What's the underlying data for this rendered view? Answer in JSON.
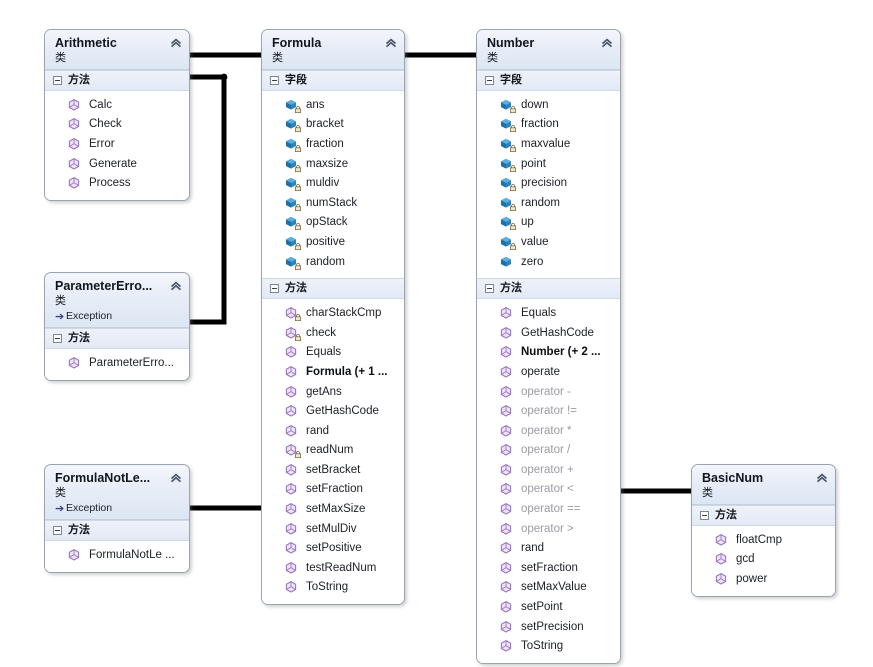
{
  "diagram": {
    "kind_label": "类",
    "section_fields_label": "字段",
    "section_methods_label": "方法",
    "collapse_icon": "chevron-double-up",
    "colors": {
      "field_icon": "#2b7bb9",
      "method_icon": "#a07cc5",
      "header_gradient_top": "#f3f6fb",
      "header_gradient_bottom": "#dde6f3",
      "connector": "#000000",
      "dimmed_text": "#9b9ba4",
      "text": "#1b1f26"
    }
  },
  "classes": [
    {
      "id": "arithmetic",
      "name": "Arithmetic",
      "kind": "类",
      "base": null,
      "sections": [
        {
          "label": "方法",
          "type": "methods",
          "members": [
            {
              "name": "Calc",
              "icon": "method-icon",
              "private": false,
              "dim": false,
              "bold": false
            },
            {
              "name": "Check",
              "icon": "method-icon",
              "private": false,
              "dim": false,
              "bold": false
            },
            {
              "name": "Error",
              "icon": "method-icon",
              "private": false,
              "dim": false,
              "bold": false
            },
            {
              "name": "Generate",
              "icon": "method-icon",
              "private": false,
              "dim": false,
              "bold": false
            },
            {
              "name": "Process",
              "icon": "method-icon",
              "private": false,
              "dim": false,
              "bold": false
            }
          ]
        }
      ]
    },
    {
      "id": "parameter-error",
      "name": "ParameterErro...",
      "kind": "类",
      "base": "Exception",
      "sections": [
        {
          "label": "方法",
          "type": "methods",
          "members": [
            {
              "name": "ParameterErro...",
              "icon": "method-icon",
              "private": false,
              "dim": false,
              "bold": false
            }
          ]
        }
      ]
    },
    {
      "id": "formula-not-legal",
      "name": "FormulaNotLe...",
      "kind": "类",
      "base": "Exception",
      "sections": [
        {
          "label": "方法",
          "type": "methods",
          "members": [
            {
              "name": "FormulaNotLe ...",
              "icon": "method-icon",
              "private": false,
              "dim": false,
              "bold": false
            }
          ]
        }
      ]
    },
    {
      "id": "formula",
      "name": "Formula",
      "kind": "类",
      "base": null,
      "sections": [
        {
          "label": "字段",
          "type": "fields",
          "members": [
            {
              "name": "ans",
              "icon": "field-icon",
              "private": true,
              "dim": false,
              "bold": false
            },
            {
              "name": "bracket",
              "icon": "field-icon",
              "private": true,
              "dim": false,
              "bold": false
            },
            {
              "name": "fraction",
              "icon": "field-icon",
              "private": true,
              "dim": false,
              "bold": false
            },
            {
              "name": "maxsize",
              "icon": "field-icon",
              "private": true,
              "dim": false,
              "bold": false
            },
            {
              "name": "muldiv",
              "icon": "field-icon",
              "private": true,
              "dim": false,
              "bold": false
            },
            {
              "name": "numStack",
              "icon": "field-icon",
              "private": true,
              "dim": false,
              "bold": false
            },
            {
              "name": "opStack",
              "icon": "field-icon",
              "private": true,
              "dim": false,
              "bold": false
            },
            {
              "name": "positive",
              "icon": "field-icon",
              "private": true,
              "dim": false,
              "bold": false
            },
            {
              "name": "random",
              "icon": "field-icon",
              "private": true,
              "dim": false,
              "bold": false
            }
          ]
        },
        {
          "label": "方法",
          "type": "methods",
          "members": [
            {
              "name": "charStackCmp",
              "icon": "method-icon",
              "private": true,
              "dim": false,
              "bold": false
            },
            {
              "name": "check",
              "icon": "method-icon",
              "private": true,
              "dim": false,
              "bold": false
            },
            {
              "name": "Equals",
              "icon": "method-icon",
              "private": false,
              "dim": false,
              "bold": false
            },
            {
              "name": "Formula (+ 1 ...",
              "icon": "method-icon",
              "private": false,
              "dim": false,
              "bold": true
            },
            {
              "name": "getAns",
              "icon": "method-icon",
              "private": false,
              "dim": false,
              "bold": false
            },
            {
              "name": "GetHashCode",
              "icon": "method-icon",
              "private": false,
              "dim": false,
              "bold": false
            },
            {
              "name": "rand",
              "icon": "method-icon",
              "private": false,
              "dim": false,
              "bold": false
            },
            {
              "name": "readNum",
              "icon": "method-icon",
              "private": true,
              "dim": false,
              "bold": false
            },
            {
              "name": "setBracket",
              "icon": "method-icon",
              "private": false,
              "dim": false,
              "bold": false
            },
            {
              "name": "setFraction",
              "icon": "method-icon",
              "private": false,
              "dim": false,
              "bold": false
            },
            {
              "name": "setMaxSize",
              "icon": "method-icon",
              "private": false,
              "dim": false,
              "bold": false
            },
            {
              "name": "setMulDiv",
              "icon": "method-icon",
              "private": false,
              "dim": false,
              "bold": false
            },
            {
              "name": "setPositive",
              "icon": "method-icon",
              "private": false,
              "dim": false,
              "bold": false
            },
            {
              "name": "testReadNum",
              "icon": "method-icon",
              "private": false,
              "dim": false,
              "bold": false
            },
            {
              "name": "ToString",
              "icon": "method-icon",
              "private": false,
              "dim": false,
              "bold": false
            }
          ]
        }
      ]
    },
    {
      "id": "number",
      "name": "Number",
      "kind": "类",
      "base": null,
      "sections": [
        {
          "label": "字段",
          "type": "fields",
          "members": [
            {
              "name": "down",
              "icon": "field-icon",
              "private": true,
              "dim": false,
              "bold": false
            },
            {
              "name": "fraction",
              "icon": "field-icon",
              "private": true,
              "dim": false,
              "bold": false
            },
            {
              "name": "maxvalue",
              "icon": "field-icon",
              "private": true,
              "dim": false,
              "bold": false
            },
            {
              "name": "point",
              "icon": "field-icon",
              "private": true,
              "dim": false,
              "bold": false
            },
            {
              "name": "precision",
              "icon": "field-icon",
              "private": true,
              "dim": false,
              "bold": false
            },
            {
              "name": "random",
              "icon": "field-icon",
              "private": true,
              "dim": false,
              "bold": false
            },
            {
              "name": "up",
              "icon": "field-icon",
              "private": true,
              "dim": false,
              "bold": false
            },
            {
              "name": "value",
              "icon": "field-icon",
              "private": true,
              "dim": false,
              "bold": false
            },
            {
              "name": "zero",
              "icon": "field-icon",
              "private": false,
              "dim": false,
              "bold": false
            }
          ]
        },
        {
          "label": "方法",
          "type": "methods",
          "members": [
            {
              "name": "Equals",
              "icon": "method-icon",
              "private": false,
              "dim": false,
              "bold": false
            },
            {
              "name": "GetHashCode",
              "icon": "method-icon",
              "private": false,
              "dim": false,
              "bold": false
            },
            {
              "name": "Number (+ 2 ...",
              "icon": "method-icon",
              "private": false,
              "dim": false,
              "bold": true
            },
            {
              "name": "operate",
              "icon": "method-icon",
              "private": false,
              "dim": false,
              "bold": false
            },
            {
              "name": "operator -",
              "icon": "method-icon",
              "private": false,
              "dim": true,
              "bold": false
            },
            {
              "name": "operator !=",
              "icon": "method-icon",
              "private": false,
              "dim": true,
              "bold": false
            },
            {
              "name": "operator *",
              "icon": "method-icon",
              "private": false,
              "dim": true,
              "bold": false
            },
            {
              "name": "operator /",
              "icon": "method-icon",
              "private": false,
              "dim": true,
              "bold": false
            },
            {
              "name": "operator +",
              "icon": "method-icon",
              "private": false,
              "dim": true,
              "bold": false
            },
            {
              "name": "operator <",
              "icon": "method-icon",
              "private": false,
              "dim": true,
              "bold": false
            },
            {
              "name": "operator ==",
              "icon": "method-icon",
              "private": false,
              "dim": true,
              "bold": false
            },
            {
              "name": "operator >",
              "icon": "method-icon",
              "private": false,
              "dim": true,
              "bold": false
            },
            {
              "name": "rand",
              "icon": "method-icon",
              "private": false,
              "dim": false,
              "bold": false
            },
            {
              "name": "setFraction",
              "icon": "method-icon",
              "private": false,
              "dim": false,
              "bold": false
            },
            {
              "name": "setMaxValue",
              "icon": "method-icon",
              "private": false,
              "dim": false,
              "bold": false
            },
            {
              "name": "setPoint",
              "icon": "method-icon",
              "private": false,
              "dim": false,
              "bold": false
            },
            {
              "name": "setPrecision",
              "icon": "method-icon",
              "private": false,
              "dim": false,
              "bold": false
            },
            {
              "name": "ToString",
              "icon": "method-icon",
              "private": false,
              "dim": false,
              "bold": false
            }
          ]
        }
      ]
    },
    {
      "id": "basic-num",
      "name": "BasicNum",
      "kind": "类",
      "base": null,
      "sections": [
        {
          "label": "方法",
          "type": "methods",
          "members": [
            {
              "name": "floatCmp",
              "icon": "method-icon",
              "private": false,
              "dim": false,
              "bold": false
            },
            {
              "name": "gcd",
              "icon": "method-icon",
              "private": false,
              "dim": false,
              "bold": false
            },
            {
              "name": "power",
              "icon": "method-icon",
              "private": false,
              "dim": false,
              "bold": false
            }
          ]
        }
      ]
    }
  ],
  "associations": [
    {
      "from": "arithmetic",
      "to": "formula",
      "label": ""
    },
    {
      "from": "formula",
      "to": "number",
      "label": ""
    },
    {
      "from": "arithmetic",
      "to": "parameter-error",
      "label": ""
    },
    {
      "from": "formula-not-legal",
      "to": "formula",
      "label": ""
    },
    {
      "from": "number",
      "to": "basic-num",
      "label": ""
    }
  ]
}
